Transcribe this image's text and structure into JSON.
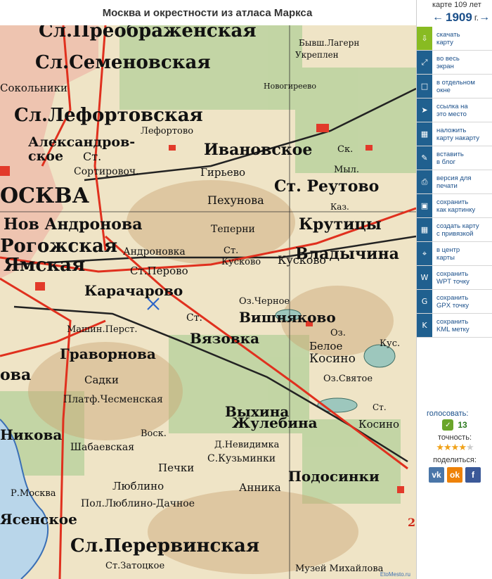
{
  "page": {
    "title": "Москва и окрестности из атласа Маркса"
  },
  "sidebar": {
    "age_text": "карте 109 лет",
    "year": "1909",
    "year_suffix": "г.",
    "prev_icon": "arrow-left-icon",
    "next_icon": "arrow-right-icon",
    "tools": [
      {
        "label": "скачать\nкарту",
        "icon": "download-icon"
      },
      {
        "label": "во весь\nэкран",
        "icon": "fullscreen-icon"
      },
      {
        "label": "в отдельном\nокне",
        "icon": "window-icon"
      },
      {
        "label": "ссылка на\nэто место",
        "icon": "link-cursor-icon"
      },
      {
        "label": "наложить\nкарту накарту",
        "icon": "overlay-icon"
      },
      {
        "label": "вставить\nв блог",
        "icon": "pencil-icon"
      },
      {
        "label": "версия для\nпечати",
        "icon": "print-icon"
      },
      {
        "label": "сохранить\nкак картинку",
        "icon": "image-icon"
      },
      {
        "label": "создать карту\nс привязкой",
        "icon": "grid-icon"
      },
      {
        "label": "в центр\nкарты",
        "icon": "center-icon"
      },
      {
        "label": "сохранить\nWPT точку",
        "icon": "wpt-icon"
      },
      {
        "label": "сохранить\nGPX точку",
        "icon": "gpx-icon"
      },
      {
        "label": "сохранить\nKML метку",
        "icon": "kml-icon"
      }
    ],
    "vote_label": "голосовать:",
    "vote_count": "13",
    "accuracy_label": "точность:",
    "accuracy_stars": 4,
    "share_label": "поделиться:",
    "social": [
      {
        "name": "vk",
        "glyph": "vk",
        "color": "#4a76a8"
      },
      {
        "name": "ok",
        "glyph": "ok",
        "color": "#ee8208"
      },
      {
        "name": "fb",
        "glyph": "f",
        "color": "#3b5998"
      }
    ]
  },
  "map": {
    "attribution": "EtoMesto.ru",
    "labels": [
      "Сл.Преображенская",
      "Сл.Семеновская",
      "Сокольники",
      "Сл.Лефортовская",
      "Лефортово",
      "Александров-",
      "ское",
      "Ст.",
      "Сортировоч.",
      "ОСКВА",
      "Нов Андронова",
      "Рогожская",
      "Ямская",
      "Андроновка",
      "Ст.Перово",
      "Ст.",
      "Кусково",
      "Карачарово",
      "Ивановское",
      "Гирьево",
      "Пехунова",
      "Ст. Реутово",
      "Теперни",
      "Кусково",
      "Владычина",
      "Вишняково",
      "Оз.Черное",
      "Ст.",
      "Вязовка",
      "Машин.Перст.",
      "Граворнова",
      "Садки",
      "Платф.Чесменская",
      "Выхина",
      "Жулебина",
      "Шабаевская",
      "Воск.",
      "Д.Невидимка",
      "С.Кузьминки",
      "Печки",
      "Люблино",
      "Анника",
      "Подосинки",
      "Пол.Люблино-Дачное",
      "Сл.Перервинская",
      "Бывш.Лагерн",
      "Укреплен",
      "Новогиреево",
      "Ск.",
      "Мыл.",
      "Каз.",
      "Крутицы",
      "Оз.",
      "Белое",
      "Косино",
      "Кус.",
      "Оз.Святое",
      "Ст.",
      "Косино",
      "Р.Москва",
      "Никова",
      "ова",
      "Ясенское",
      "Ст.Затоцкое",
      "Музей Михайлова"
    ]
  }
}
